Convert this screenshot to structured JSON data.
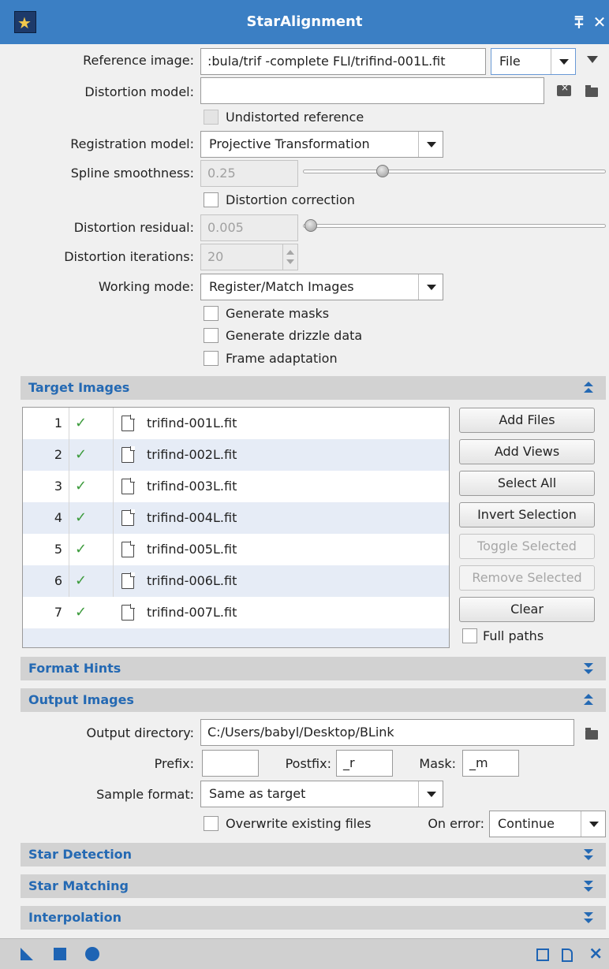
{
  "window": {
    "title": "StarAlignment"
  },
  "titlebar": {
    "pin_icon": "pin-icon",
    "close_icon": "close-icon"
  },
  "fields": {
    "reference_image_label": "Reference image:",
    "reference_image_value": ":bula/trif -complete FLI/trifind-001L.fit",
    "reference_source": "File",
    "distortion_model_label": "Distortion model:",
    "distortion_model_value": "",
    "undistorted_reference_label": "Undistorted reference",
    "registration_model_label": "Registration model:",
    "registration_model_value": "Projective Transformation",
    "spline_smoothness_label": "Spline smoothness:",
    "spline_smoothness_value": "0.25",
    "distortion_correction_label": "Distortion correction",
    "distortion_residual_label": "Distortion residual:",
    "distortion_residual_value": "0.005",
    "distortion_iterations_label": "Distortion iterations:",
    "distortion_iterations_value": "20",
    "working_mode_label": "Working mode:",
    "working_mode_value": "Register/Match Images",
    "generate_masks_label": "Generate masks",
    "generate_drizzle_label": "Generate drizzle data",
    "frame_adaptation_label": "Frame adaptation"
  },
  "sections": {
    "target_images": "Target Images",
    "format_hints": "Format Hints",
    "output_images": "Output Images",
    "star_detection": "Star Detection",
    "star_matching": "Star Matching",
    "interpolation": "Interpolation"
  },
  "target_images": [
    {
      "index": "1",
      "enabled": true,
      "name": "trifind-001L.fit"
    },
    {
      "index": "2",
      "enabled": true,
      "name": "trifind-002L.fit"
    },
    {
      "index": "3",
      "enabled": true,
      "name": "trifind-003L.fit"
    },
    {
      "index": "4",
      "enabled": true,
      "name": "trifind-004L.fit"
    },
    {
      "index": "5",
      "enabled": true,
      "name": "trifind-005L.fit"
    },
    {
      "index": "6",
      "enabled": true,
      "name": "trifind-006L.fit"
    },
    {
      "index": "7",
      "enabled": true,
      "name": "trifind-007L.fit"
    }
  ],
  "target_buttons": {
    "add_files": "Add Files",
    "add_views": "Add Views",
    "select_all": "Select All",
    "invert_selection": "Invert Selection",
    "toggle_selected": "Toggle Selected",
    "remove_selected": "Remove Selected",
    "clear": "Clear",
    "full_paths": "Full paths"
  },
  "output": {
    "directory_label": "Output directory:",
    "directory_value": "C:/Users/babyl/Desktop/BLink",
    "prefix_label": "Prefix:",
    "prefix_value": "",
    "postfix_label": "Postfix:",
    "postfix_value": "_r",
    "mask_label": "Mask:",
    "mask_value": "_m",
    "sample_format_label": "Sample format:",
    "sample_format_value": "Same as target",
    "overwrite_label": "Overwrite existing files",
    "on_error_label": "On error:",
    "on_error_value": "Continue"
  },
  "sliders": {
    "spline_smoothness_level": 0.25,
    "distortion_residual_level": 0.0
  },
  "colors": {
    "titlebar": "#3b7fc4",
    "section_title": "#2469b3",
    "check": "#3c9b3c",
    "bottom_icons": "#1e64b4"
  }
}
